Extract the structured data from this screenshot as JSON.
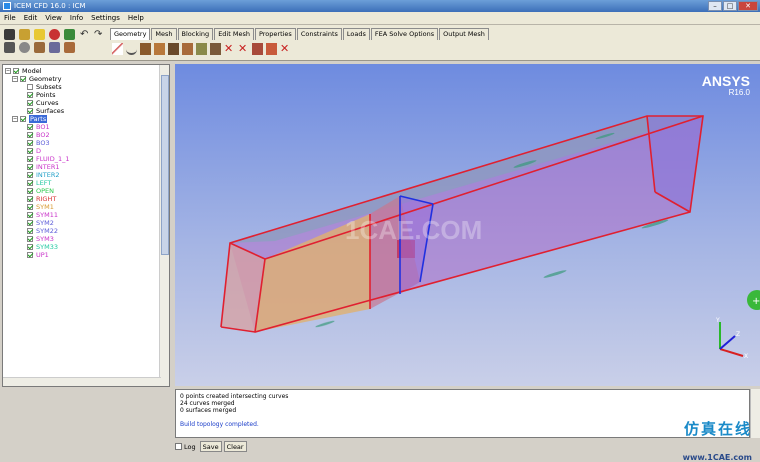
{
  "window": {
    "title": "ICEM CFD 16.0 : ICM"
  },
  "menu": [
    "File",
    "Edit",
    "View",
    "Info",
    "Settings",
    "Help"
  ],
  "tabs": [
    "Geometry",
    "Mesh",
    "Blocking",
    "Edit Mesh",
    "Properties",
    "Constraints",
    "Loads",
    "FEA Solve Options",
    "Output Mesh"
  ],
  "tree": {
    "root": "Model",
    "geometry": "Geometry",
    "geometry_items": [
      "Subsets",
      "Points",
      "Curves",
      "Surfaces"
    ],
    "parts": "Parts",
    "part_items": [
      {
        "label": "BO1",
        "color": "#c832c8"
      },
      {
        "label": "BO2",
        "color": "#c832c8"
      },
      {
        "label": "BO3",
        "color": "#5a5ad8"
      },
      {
        "label": "D",
        "color": "#c832c8"
      },
      {
        "label": "FLUID_1_1",
        "color": "#c832c8"
      },
      {
        "label": "INTER1",
        "color": "#c832c8"
      },
      {
        "label": "INTER2",
        "color": "#22a0c8"
      },
      {
        "label": "LEFT",
        "color": "#22c8a0"
      },
      {
        "label": "OPEN",
        "color": "#2ac84a"
      },
      {
        "label": "RIGHT",
        "color": "#d83232"
      },
      {
        "label": "SYM1",
        "color": "#d89a32"
      },
      {
        "label": "SYM11",
        "color": "#c832c8"
      },
      {
        "label": "SYM2",
        "color": "#5a5ad8"
      },
      {
        "label": "SYM22",
        "color": "#5a5ad8"
      },
      {
        "label": "SYM3",
        "color": "#c832c8"
      },
      {
        "label": "SYM33",
        "color": "#22c8a0"
      },
      {
        "label": "UP1",
        "color": "#c832c8"
      }
    ]
  },
  "viewport": {
    "brand": "ANSYS",
    "version": "R16.0",
    "watermark": "1CAE.COM"
  },
  "console": {
    "lines": [
      "0 points created intersecting curves",
      "24 curves merged",
      "0 surfaces merged"
    ],
    "status": "Build topology completed.",
    "log_label": "Log",
    "save_label": "Save",
    "clear_label": "Clear"
  },
  "watermark": {
    "cn": "仿真在线",
    "url": "www.1CAE.com"
  }
}
